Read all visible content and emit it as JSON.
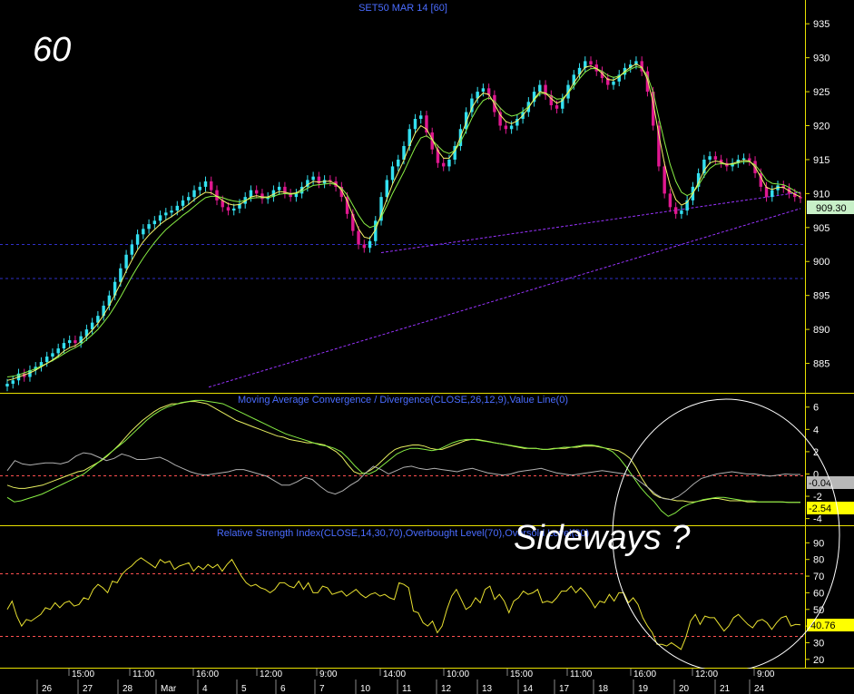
{
  "price_panel": {
    "title": "SET50 MAR 14   [60]",
    "timeframe_label": "60",
    "y_ticks": [
      935,
      930,
      925,
      920,
      915,
      910,
      905,
      900,
      895,
      890,
      885
    ],
    "last_price_tag": "909.30",
    "ylim": [
      880.8,
      938.5
    ]
  },
  "macd_panel": {
    "title": "Moving Average Convergence / Divergence(CLOSE,26,12,9),Value Line(0)",
    "y_ticks": [
      6,
      4,
      2,
      0,
      -2,
      -4
    ],
    "tag_1": "-0.04",
    "tag_2": "-2.54",
    "ylim": [
      -4.6,
      7.2
    ]
  },
  "rsi_panel": {
    "title": "Relative Strength Index(CLOSE,14,30,70),Overbought Level(70),Oversold Level(30)",
    "y_ticks": [
      90,
      80,
      70,
      60,
      50,
      40,
      30,
      20
    ],
    "last_tag": "40.76",
    "ylim": [
      15,
      100
    ]
  },
  "annotation": {
    "text": "Sideways ?"
  },
  "time_axis": {
    "row1": [
      "15:00",
      "11:00",
      "16:00",
      "12:00",
      "9:00",
      "14:00",
      "10:00",
      "15:00",
      "11:00",
      "16:00",
      "12:00",
      "9:00"
    ],
    "row2": [
      "26",
      "27",
      "28",
      "Mar",
      "4",
      "5",
      "6",
      "7",
      "10",
      "11",
      "12",
      "13",
      "14",
      "17",
      "18",
      "19",
      "20",
      "21",
      "24"
    ]
  },
  "chart_data": [
    {
      "type": "candlestick",
      "title": "SET50 MAR 14   [60]",
      "ylim": [
        880.8,
        938.5
      ],
      "bull_color": "#33e0f0",
      "bear_color": "#e01890",
      "ma_fast_color": "#f4f46a",
      "ma_slow_color": "#88ee44",
      "trendline_color": "#9933ff",
      "closes": [
        882,
        882.5,
        883.5,
        883,
        884,
        884.5,
        885.2,
        886,
        886.5,
        887.2,
        888,
        888.4,
        888,
        889,
        890,
        891,
        892,
        893.5,
        895,
        897,
        899,
        901,
        902.5,
        904,
        904.8,
        905.5,
        906,
        906.8,
        907.2,
        907.5,
        908.2,
        909,
        909.5,
        910.5,
        911,
        911.8,
        910.5,
        909,
        908,
        907.5,
        907.8,
        908.5,
        909.5,
        910.5,
        910,
        909.2,
        909.5,
        910.5,
        911,
        910,
        909.5,
        910,
        911,
        912,
        912.5,
        911.5,
        912,
        911.8,
        911,
        909.5,
        907,
        904.5,
        902.5,
        902,
        903,
        906,
        909.5,
        912,
        914,
        915,
        917,
        919.5,
        921,
        921.5,
        919,
        916.5,
        914.5,
        914,
        915,
        917,
        919.5,
        922,
        924,
        925,
        925.5,
        924.5,
        922,
        920,
        919.5,
        920,
        921,
        922,
        923.5,
        925,
        926,
        924.5,
        923,
        922.5,
        924,
        926,
        927.5,
        928.5,
        929.5,
        929,
        928,
        927,
        926,
        926.5,
        927.5,
        928.5,
        929,
        929.5,
        928,
        925,
        920,
        914,
        910,
        908,
        907,
        907.5,
        909,
        911,
        913,
        915,
        915.5,
        915,
        914.5,
        914,
        914.5,
        915,
        915.2,
        914.8,
        913,
        911,
        909.5,
        910.5,
        911.2,
        910.8,
        910,
        909.5,
        909.3
      ],
      "ma_fast": [
        882.5,
        882.7,
        883,
        883.3,
        883.6,
        884,
        884.5,
        885,
        885.5,
        886.1,
        886.8,
        887.3,
        887.6,
        888.2,
        889,
        889.9,
        890.9,
        892.1,
        893.5,
        895.1,
        896.8,
        898.6,
        900.2,
        901.7,
        902.9,
        903.9,
        904.7,
        905.5,
        906.1,
        906.6,
        907.2,
        907.8,
        908.4,
        909.1,
        909.7,
        910.2,
        910.1,
        909.6,
        909,
        908.5,
        908.3,
        908.4,
        908.9,
        909.5,
        909.7,
        909.5,
        909.5,
        909.9,
        910.3,
        910.2,
        910,
        910.1,
        910.6,
        911.3,
        911.8,
        911.7,
        911.8,
        911.8,
        911.4,
        910.5,
        908.9,
        906.8,
        904.8,
        903.6,
        903.4,
        904.7,
        906.9,
        909.2,
        911.4,
        913.1,
        914.9,
        917,
        918.9,
        920,
        919.5,
        918,
        916.3,
        915.2,
        915.2,
        916.3,
        918.3,
        920.5,
        922.6,
        924,
        924.8,
        924.6,
        923.2,
        921.6,
        920.6,
        920.3,
        920.7,
        921.5,
        922.6,
        923.9,
        925,
        924.8,
        924,
        923.3,
        923.7,
        924.9,
        926.3,
        927.5,
        928.6,
        928.8,
        928.4,
        927.7,
        926.8,
        926.7,
        927.2,
        928,
        928.6,
        929.1,
        928.6,
        926.8,
        923.4,
        918.7,
        914.4,
        911.2,
        909.1,
        908.3,
        908.7,
        910,
        911.6,
        913.4,
        914.5,
        914.8,
        914.6,
        914.3,
        914.4,
        914.7,
        914.9,
        914.8,
        913.9,
        912.4,
        910.9,
        910.6,
        910.9,
        910.9,
        910.4,
        909.9,
        909.5
      ],
      "ma_slow": [
        883,
        883.1,
        883.3,
        883.6,
        883.9,
        884.2,
        884.6,
        885,
        885.4,
        885.9,
        886.4,
        886.9,
        887.3,
        887.8,
        888.5,
        889.2,
        890,
        891,
        892.1,
        893.4,
        894.8,
        896.3,
        897.8,
        899.2,
        900.5,
        901.7,
        902.8,
        903.8,
        904.7,
        905.4,
        906.1,
        906.8,
        907.4,
        908.1,
        908.8,
        909.4,
        909.6,
        909.6,
        909.4,
        909.1,
        908.9,
        908.8,
        909,
        909.3,
        909.4,
        909.4,
        909.4,
        909.6,
        909.9,
        910,
        909.9,
        910,
        910.3,
        910.8,
        911.2,
        911.3,
        911.4,
        911.5,
        911.3,
        910.8,
        909.8,
        908.3,
        906.8,
        905.6,
        905,
        905.3,
        906.5,
        908.2,
        910,
        911.6,
        913.2,
        915,
        916.8,
        918.2,
        918.5,
        917.9,
        917,
        916.2,
        915.9,
        916.3,
        917.6,
        919.3,
        921.1,
        922.6,
        923.7,
        924.1,
        923.6,
        922.6,
        921.8,
        921.4,
        921.6,
        922.1,
        922.8,
        923.8,
        924.7,
        924.8,
        924.4,
        923.9,
        924,
        924.8,
        925.8,
        926.9,
        927.9,
        928.4,
        928.4,
        928,
        927.4,
        927.1,
        927.3,
        927.8,
        928.3,
        928.7,
        928.5,
        927.3,
        924.9,
        921.2,
        917.6,
        914.3,
        911.8,
        910.2,
        909.7,
        910.1,
        911.2,
        912.6,
        913.7,
        914.3,
        914.4,
        914.3,
        914.3,
        914.5,
        914.7,
        914.7,
        914.2,
        913.2,
        912,
        911.5,
        911.4,
        911.3,
        910.9,
        910.4,
        910
      ]
    },
    {
      "type": "line",
      "title": "Moving Average Convergence / Divergence(CLOSE,26,12,9),Value Line(0)",
      "ylim": [
        -4.6,
        7.2
      ],
      "series": [
        {
          "color": "#e8f060",
          "values": [
            -1,
            -1.2,
            -1.3,
            -1.3,
            -1.2,
            -1.1,
            -1,
            -0.8,
            -0.6,
            -0.4,
            -0.2,
            0,
            0.2,
            0.3,
            0.6,
            0.9,
            1.2,
            1.6,
            2.1,
            2.6,
            3.2,
            3.8,
            4.3,
            4.8,
            5.2,
            5.6,
            5.9,
            6.1,
            6.3,
            6.3,
            6.4,
            6.5,
            6.5,
            6.4,
            6.3,
            6,
            5.7,
            5.4,
            5.1,
            4.8,
            4.6,
            4.4,
            4.2,
            4,
            3.8,
            3.6,
            3.4,
            3.3,
            3.1,
            3,
            2.9,
            2.8,
            2.8,
            2.7,
            2.6,
            2.3,
            2,
            1.5,
            0.8,
            0.2,
            0,
            0.1,
            0.4,
            0.8,
            1.3,
            1.8,
            2.2,
            2.4,
            2.5,
            2.6,
            2.6,
            2.5,
            2.3,
            2.2,
            2.2,
            2.4,
            2.6,
            2.8,
            3,
            3.1,
            3.1,
            3,
            2.9,
            2.8,
            2.7,
            2.6,
            2.5,
            2.4,
            2.3,
            2.3,
            2.3,
            2.2,
            2.2,
            2.3,
            2.3,
            2.3,
            2.4,
            2.4,
            2.5,
            2.5,
            2.5,
            2.4,
            2.3,
            2.2,
            2.1,
            1.8,
            1.4,
            0.6,
            -0.4,
            -1.2,
            -1.8,
            -2.1,
            -2.2,
            -2.3,
            -2.4,
            -2.4,
            -2.5,
            -2.5,
            -2.4,
            -2.3,
            -2.2,
            -2.2,
            -2.3,
            -2.4,
            -2.4,
            -2.4,
            -2.5,
            -2.5,
            -2.5,
            -2.5,
            -2.5,
            -2.5,
            -2.5,
            -2.54,
            -2.54,
            -2.54
          ]
        },
        {
          "color": "#88ee44",
          "values": [
            -2.1,
            -2.5,
            -2.4,
            -2.2,
            -2,
            -1.8,
            -1.5,
            -1.2,
            -0.9,
            -0.6,
            -0.3,
            0,
            0.5,
            1,
            1.5,
            2,
            2.5,
            3,
            3.6,
            4.2,
            4.8,
            5.3,
            5.7,
            6,
            6.2,
            6.4,
            6.5,
            6.6,
            6.6,
            6.5,
            6.4,
            6.3,
            6,
            5.7,
            5.4,
            5.1,
            4.8,
            4.5,
            4.2,
            3.9,
            3.6,
            3.4,
            3.2,
            3,
            2.8,
            2.6,
            2.5,
            2.3,
            2,
            1.4,
            0.7,
            0.1,
            0,
            0.3,
            0.8,
            1.3,
            1.8,
            2.1,
            2.3,
            2.3,
            2.2,
            2.1,
            2.2,
            2.5,
            2.8,
            3,
            3.1,
            3.1,
            3,
            2.9,
            2.8,
            2.7,
            2.6,
            2.5,
            2.4,
            2.3,
            2.3,
            2.2,
            2.2,
            2.3,
            2.4,
            2.4,
            2.5,
            2.6,
            2.6,
            2.5,
            2.3,
            2,
            1.4,
            0.6,
            -0.3,
            -1.2,
            -1.9,
            -2.5,
            -3.3,
            -3.8,
            -3.5,
            -3,
            -2.7,
            -2.5,
            -2.3,
            -2.2,
            -2.1,
            -2.1,
            -2.2,
            -2.3,
            -2.4,
            -2.4,
            -2.5,
            -2.5,
            -2.5,
            -2.5,
            -2.54,
            -2.54,
            -2.54
          ]
        },
        {
          "color": "#b0b0b0",
          "values": [
            0.3,
            1.2,
            0.9,
            0.8,
            0.9,
            1,
            1,
            0.9,
            1.1,
            1.6,
            1.9,
            1.8,
            1.5,
            1.2,
            1.4,
            1.8,
            1.6,
            1.3,
            1.3,
            1.4,
            1.5,
            1.2,
            0.8,
            0.5,
            0.2,
            0,
            -0.1,
            0,
            0.1,
            0.2,
            0.4,
            0.4,
            0.2,
            0,
            -0.2,
            -0.6,
            -1,
            -1,
            -0.7,
            -0.3,
            -0.5,
            -1.1,
            -1.6,
            -1.8,
            -1.5,
            -1,
            -0.6,
            0.1,
            0.7,
            0.4,
            0,
            0.3,
            0.6,
            0.7,
            0.5,
            0.4,
            0.5,
            0.4,
            0.3,
            0.2,
            0.4,
            0.5,
            0.3,
            0.1,
            0,
            -0.1,
            0,
            0.2,
            0.3,
            0.4,
            0.5,
            0.3,
            0.1,
            0,
            -0.1,
            0,
            0.1,
            0.2,
            0.3,
            0.2,
            0.1,
            0,
            -0.2,
            -0.7,
            -1.2,
            -1.8,
            -2.2,
            -2.3,
            -2,
            -1.5,
            -0.9,
            -0.4,
            -0.2,
            0,
            0.1,
            0.2,
            0.1,
            0,
            0,
            -0.1,
            -0.2,
            -0.1,
            0,
            -0.04,
            -0.04
          ]
        }
      ]
    },
    {
      "type": "line",
      "title": "Relative Strength Index(CLOSE,14,30,70),Overbought Level(70),Oversold Level(30)",
      "ylim": [
        15,
        100
      ],
      "levels": [
        70,
        30
      ],
      "series": [
        {
          "color": "#e8e030",
          "values": [
            50,
            55,
            46,
            40,
            44,
            43,
            45,
            47,
            51,
            50,
            54,
            51,
            54,
            55,
            52,
            53,
            57,
            56,
            62,
            65,
            63,
            60,
            67,
            66,
            71,
            74,
            76,
            79,
            81,
            79,
            77,
            75,
            80,
            78,
            79,
            74,
            76,
            77,
            78,
            73,
            76,
            74,
            77,
            75,
            77,
            73,
            77,
            80,
            75,
            70,
            66,
            64,
            65,
            63,
            62,
            60,
            62,
            66,
            66,
            64,
            63,
            67,
            62,
            66,
            60,
            60,
            64,
            63,
            59,
            60,
            61,
            58,
            60,
            62,
            59,
            57,
            59,
            60,
            58,
            59,
            57,
            56,
            66,
            65,
            63,
            49,
            48,
            42,
            40,
            43,
            36,
            40,
            50,
            58,
            62,
            56,
            50,
            52,
            57,
            54,
            62,
            64,
            56,
            59,
            55,
            48,
            55,
            57,
            61,
            59,
            60,
            62,
            54,
            55,
            54,
            57,
            61,
            61,
            64,
            60,
            63,
            60,
            56,
            51,
            55,
            54,
            59,
            55,
            60,
            60,
            54,
            57,
            53,
            45,
            40,
            36,
            29,
            29,
            28,
            30,
            28,
            26,
            33,
            43,
            47,
            41,
            46,
            45,
            45,
            41,
            37,
            40,
            45,
            47,
            44,
            41,
            39,
            43,
            44,
            42,
            38,
            42,
            45,
            46,
            40,
            41,
            40.76
          ]
        }
      ]
    }
  ]
}
